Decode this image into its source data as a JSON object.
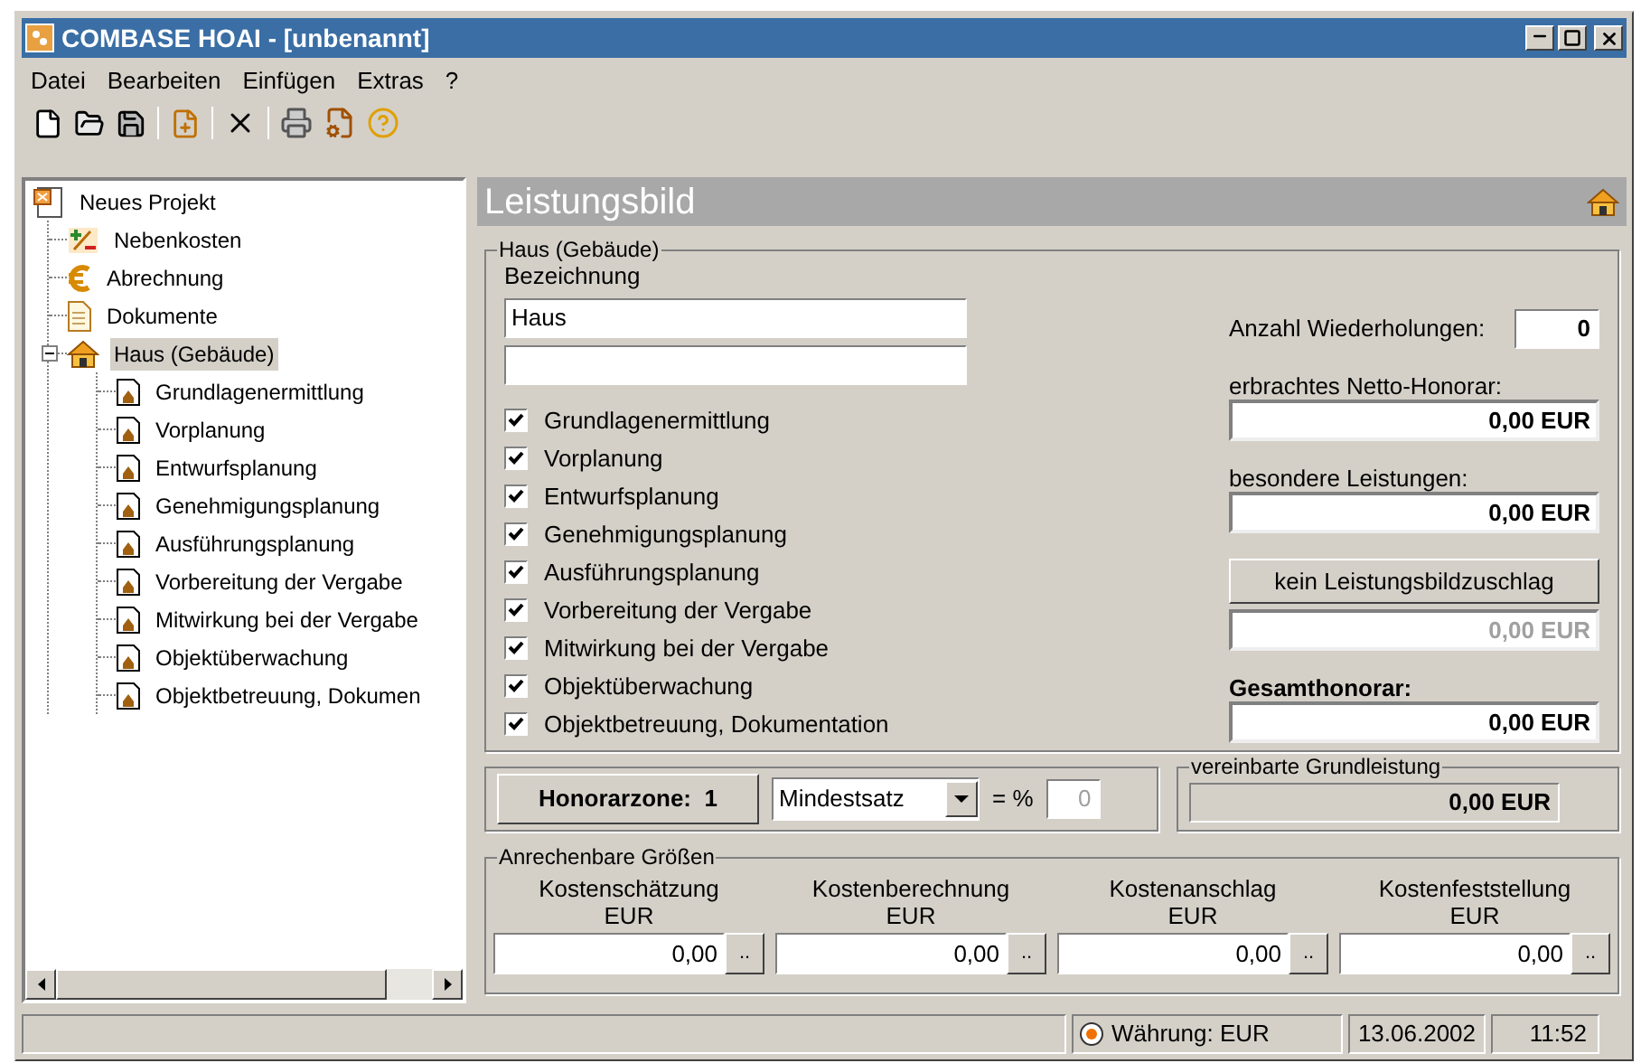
{
  "window": {
    "title": "COMBASE HOAI - [unbenannt]"
  },
  "menu": [
    {
      "label": "Datei"
    },
    {
      "label": "Bearbeiten"
    },
    {
      "label": "Einfügen"
    },
    {
      "label": "Extras"
    },
    {
      "label": "?"
    }
  ],
  "tree": {
    "label": "Neues Projekt",
    "kind": "project",
    "selected": false,
    "expanded": true,
    "children": [
      {
        "label": "Nebenkosten",
        "kind": "costs",
        "selected": false
      },
      {
        "label": "Abrechnung",
        "kind": "euro",
        "selected": false
      },
      {
        "label": "Dokumente",
        "kind": "document",
        "selected": false
      },
      {
        "label": "Haus (Gebäude)",
        "kind": "house",
        "selected": true,
        "expanded": true,
        "children": [
          {
            "label": "Grundlagenermittlung",
            "kind": "phase",
            "selected": false
          },
          {
            "label": "Vorplanung",
            "kind": "phase",
            "selected": false
          },
          {
            "label": "Entwurfsplanung",
            "kind": "phase",
            "selected": false
          },
          {
            "label": "Genehmigungsplanung",
            "kind": "phase",
            "selected": false
          },
          {
            "label": "Ausführungsplanung",
            "kind": "phase",
            "selected": false
          },
          {
            "label": "Vorbereitung der Vergabe",
            "kind": "phase",
            "selected": false
          },
          {
            "label": "Mitwirkung bei der Vergabe",
            "kind": "phase",
            "selected": false
          },
          {
            "label": "Objektüberwachung",
            "kind": "phase",
            "selected": false
          },
          {
            "label": "Objektbetreuung, Dokumen",
            "kind": "phase",
            "selected": false
          }
        ]
      }
    ]
  },
  "panel": {
    "title": "Leistungsbild",
    "group": {
      "title": "Haus (Gebäude)",
      "name_label": "Bezeichnung",
      "name_value": "Haus",
      "phases": [
        {
          "label": "Grundlagenermittlung",
          "checked": true
        },
        {
          "label": "Vorplanung",
          "checked": true
        },
        {
          "label": "Entwurfsplanung",
          "checked": true
        },
        {
          "label": "Genehmigungsplanung",
          "checked": true
        },
        {
          "label": "Ausführungsplanung",
          "checked": true
        },
        {
          "label": "Vorbereitung der Vergabe",
          "checked": true
        },
        {
          "label": "Mitwirkung bei der Vergabe",
          "checked": true
        },
        {
          "label": "Objektüberwachung",
          "checked": true
        },
        {
          "label": "Objektbetreuung, Dokumentation",
          "checked": true
        }
      ],
      "repetitions": {
        "label": "Anzahl Wiederholungen:",
        "value": "0"
      },
      "amounts": [
        {
          "kind": "field",
          "label": "erbrachtes Netto-Honorar:",
          "value": "0,00 EUR",
          "disabled": false,
          "bold_label": false
        },
        {
          "kind": "field",
          "label": "besondere Leistungen:",
          "value": "0,00 EUR",
          "disabled": false,
          "bold_label": false
        },
        {
          "kind": "button",
          "label": "kein Leistungsbildzuschlag",
          "value": "0,00 EUR",
          "disabled": true
        },
        {
          "kind": "field",
          "label": "Gesamthonorar:",
          "value": "0,00 EUR",
          "disabled": false,
          "bold_label": true
        }
      ]
    },
    "zone": {
      "button_label": "Honorarzone:",
      "button_value": "1",
      "rate": "Mindestsatz",
      "percent_label": "= %",
      "percent_value": "0"
    },
    "agreed": {
      "title": "vereinbarte Grundleistung",
      "value": "0,00 EUR"
    },
    "costs": {
      "title": "Anrechenbare Größen",
      "columns": [
        {
          "label": "Kostenschätzung",
          "unit": "EUR",
          "value": "0,00",
          "button": ".."
        },
        {
          "label": "Kostenberechnung",
          "unit": "EUR",
          "value": "0,00",
          "button": ".."
        },
        {
          "label": "Kostenanschlag",
          "unit": "EUR",
          "value": "0,00",
          "button": ".."
        },
        {
          "label": "Kostenfeststellung",
          "unit": "EUR",
          "value": "0,00",
          "button": ".."
        }
      ]
    }
  },
  "status_bar": {
    "currency": "Währung: EUR",
    "date": "13.06.2002",
    "time": "11:52"
  }
}
